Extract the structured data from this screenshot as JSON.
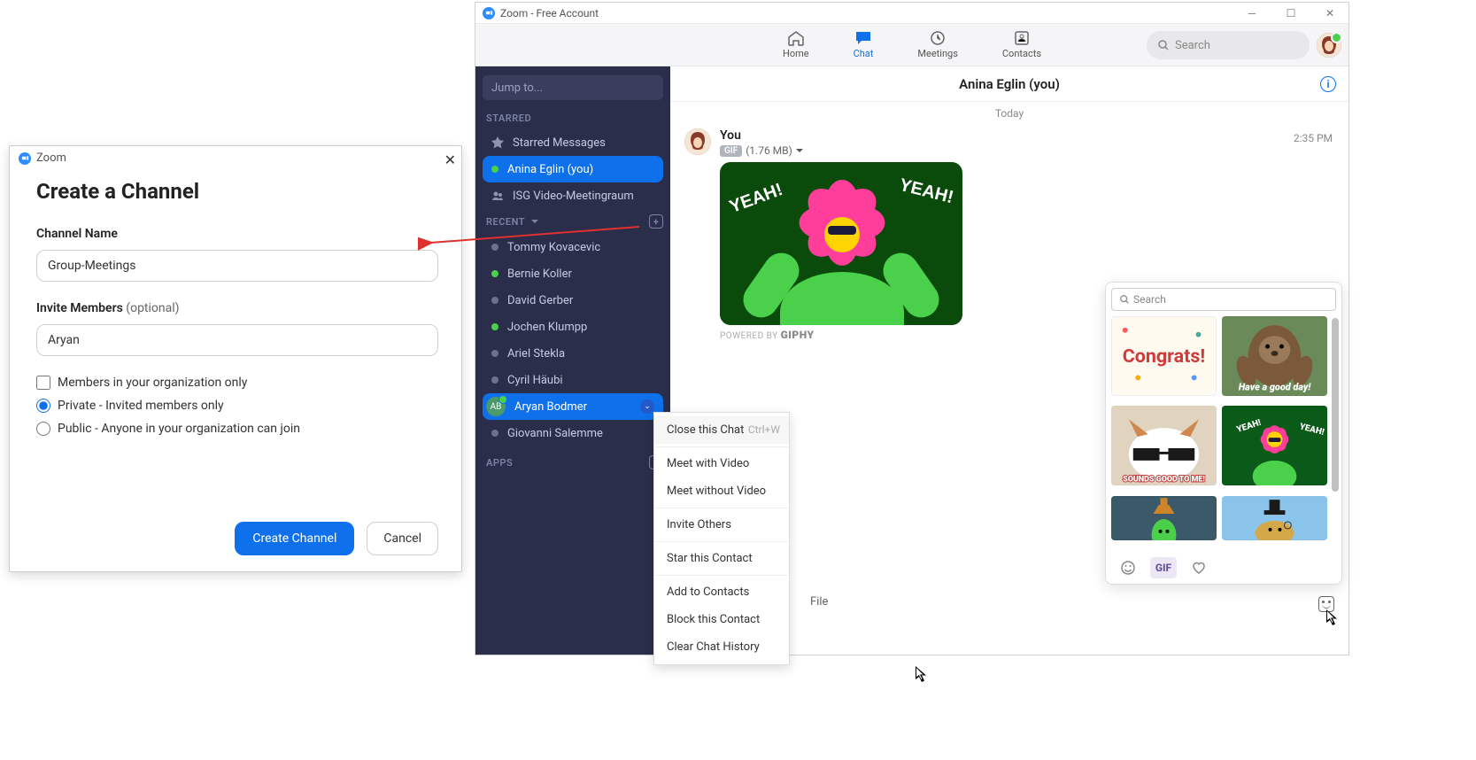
{
  "dialog": {
    "window_title": "Zoom",
    "heading": "Create a Channel",
    "channel_name_label": "Channel Name",
    "channel_name_value": "Group-Meetings",
    "invite_label": "Invite Members",
    "invite_optional": "(optional)",
    "invite_value": "Aryan",
    "checkbox_org_only": "Members in your organization only",
    "radio_private": "Private - Invited members only",
    "radio_public": "Public - Anyone in your organization can join",
    "create_button": "Create Channel",
    "cancel_button": "Cancel"
  },
  "zoom": {
    "title": "Zoom - Free Account",
    "nav": {
      "home": "Home",
      "chat": "Chat",
      "meetings": "Meetings",
      "contacts": "Contacts"
    },
    "search_placeholder": "Search",
    "sidebar": {
      "jump": "Jump to...",
      "section_starred": "STARRED",
      "section_recent": "RECENT",
      "section_apps": "APPS",
      "starred_messages": "Starred Messages",
      "self": "Anina Eglin (you)",
      "isg": "ISG Video-Meetingraum",
      "recent": [
        "Tommy Kovacevic",
        "Bernie Koller",
        "David Gerber",
        "Jochen Klumpp",
        "Ariel Stekla",
        "Cyril Häubi",
        "Aryan Bodmer",
        "Giovanni Salemme"
      ],
      "aryan_initials": "AB"
    },
    "chat": {
      "header": "Anina Eglin (you)",
      "date": "Today",
      "sender": "You",
      "gif_label": "GIF",
      "gif_size": "(1.76 MB)",
      "time": "2:35 PM",
      "yeah": "YEAH!",
      "giphy_prefix": "POWERED BY",
      "giphy": "GIPHY",
      "file": "File"
    }
  },
  "context_menu": {
    "items": [
      {
        "label": "Close this Chat",
        "shortcut": "Ctrl+W"
      },
      {
        "label": "Meet with Video"
      },
      {
        "label": "Meet without Video"
      },
      {
        "label": "Invite Others"
      },
      {
        "label": "Star this Contact"
      },
      {
        "label": "Add to Contacts"
      },
      {
        "label": "Block this Contact"
      },
      {
        "label": "Clear Chat History"
      }
    ]
  },
  "gif_picker": {
    "search_placeholder": "Search",
    "gif_tab": "GIF",
    "cells": {
      "congrats": "Congrats!",
      "goodday": "Have a good day!",
      "sounds": "SOUNDS GOOD TO ME!",
      "yeah": "YEAH!"
    }
  }
}
